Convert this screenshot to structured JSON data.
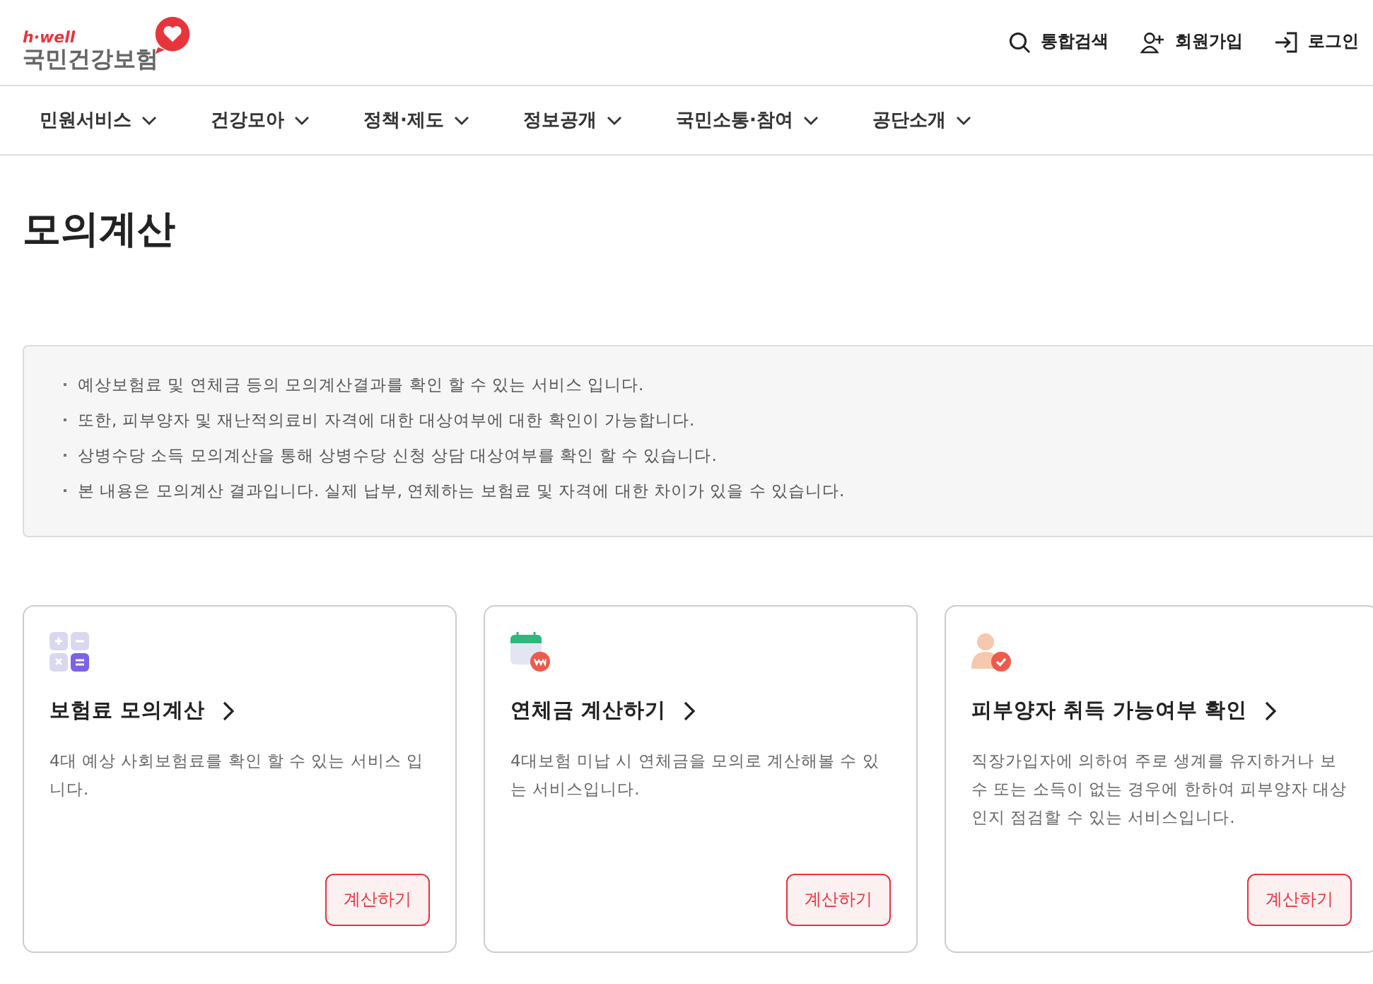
{
  "logo": {
    "tagline": "h·well",
    "name": "국민건강보험"
  },
  "utility": [
    {
      "kind": "search",
      "label": "통합검색"
    },
    {
      "kind": "signup",
      "label": "회원가입"
    },
    {
      "kind": "login",
      "label": "로그인"
    }
  ],
  "nav": [
    "민원서비스",
    "건강모아",
    "정책·제도",
    "정보공개",
    "국민소통·참여",
    "공단소개"
  ],
  "page_title": "모의계산",
  "notice": [
    "예상보험료 및 연체금 등의 모의계산결과를 확인 할 수 있는 서비스 입니다.",
    "또한, 피부양자 및 재난적의료비 자격에 대한 대상여부에 대한 확인이 가능합니다.",
    "상병수당 소득 모의계산을 통해 상병수당 신청 상담 대상여부를 확인 할 수 있습니다.",
    "본 내용은 모의계산 결과입니다. 실제 납부, 연체하는 보험료 및 자격에 대한 차이가 있을 수 있습니다."
  ],
  "cards": [
    {
      "kind": "calculator",
      "title": "보험료 모의계산",
      "description": "4대 예상 사회보험료를 확인 할 수 있는 서비스 입니다.",
      "button": "계산하기"
    },
    {
      "kind": "calendar",
      "title": "연체금 계산하기",
      "description": "4대보험 미납 시 연체금을 모의로 계산해볼 수 있는 서비스입니다.",
      "button": "계산하기"
    },
    {
      "kind": "person",
      "title": "피부양자 취득 가능여부 확인",
      "description": "직장가입자에 의하여 주로 생계를 유지하거나 보수 또는 소득이 없는 경우에 한하여 피부양자 대상인지 점검할 수 있는 서비스입니다.",
      "button": "계산하기"
    }
  ]
}
